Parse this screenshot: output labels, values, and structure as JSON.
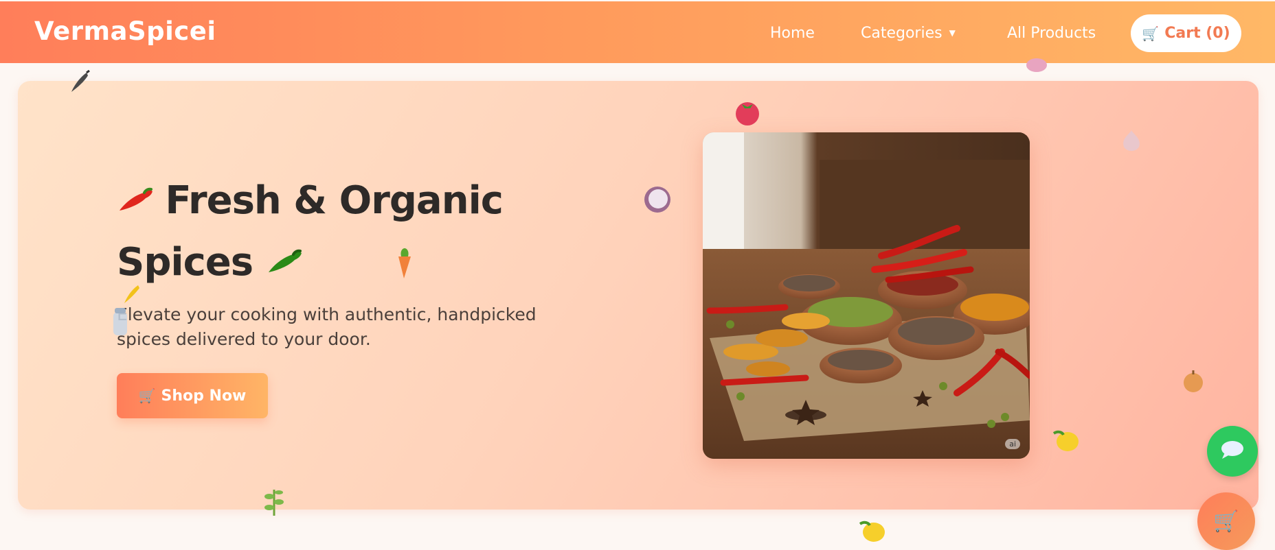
{
  "nav": {
    "brand": "VermaSpicei",
    "links": [
      {
        "label": "Home"
      },
      {
        "label": "Categories",
        "caret": "▼"
      },
      {
        "label": "All Products"
      }
    ],
    "cart_label": "Cart (0)",
    "cart_icon": "🛒"
  },
  "hero": {
    "title_line1": "Fresh & Organic",
    "title_line2": "Spices",
    "description": "Elevate your cooking with authentic, handpicked spices delivered to your door.",
    "cta_label": "Shop Now",
    "cta_icon": "🛒",
    "image_badge": "ai"
  },
  "icons": {
    "title_left": "red-chili-icon",
    "title_right": "green-chili-icon",
    "chat": "chat-bubble-icon",
    "floating_cart": "cart-icon"
  },
  "colors": {
    "nav_start": "#ff7e5a",
    "nav_end": "#ffb866",
    "accent": "#f27a52",
    "chat_green": "#2ec95f",
    "heading": "#2e2a28"
  }
}
